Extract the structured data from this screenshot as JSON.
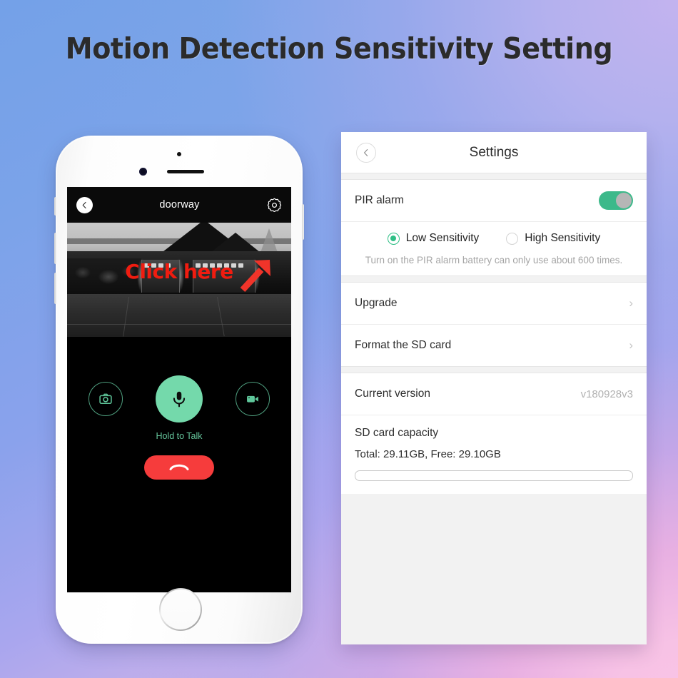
{
  "page": {
    "title": "Motion Detection Sensitivity Setting",
    "bg_from": "#74a1e8",
    "bg_to": "#f2c0e4"
  },
  "phone": {
    "app": {
      "back_icon": "chevron-left-icon",
      "title": "doorway",
      "gear_icon": "gear-icon"
    },
    "annotation": {
      "text": "Click here",
      "color": "#f01c10",
      "arrow_icon": "arrow-up-right-icon"
    },
    "controls": {
      "snapshot_icon": "camera-icon",
      "talk_icon": "microphone-icon",
      "record_icon": "video-camera-icon",
      "talk_label": "Hold to Talk",
      "hangup_icon": "phone-hangup-icon",
      "accent": "#74d9ab",
      "hangup_color": "#f63c3c"
    }
  },
  "settings": {
    "header": {
      "back_icon": "chevron-left-icon",
      "title": "Settings"
    },
    "pir": {
      "label": "PIR alarm",
      "toggle_on": true,
      "toggle_color": "#3cb98a",
      "options": [
        {
          "label": "Low Sensitivity",
          "selected": true
        },
        {
          "label": "High Sensitivity",
          "selected": false
        }
      ],
      "hint": "Turn on the PIR alarm battery can only use about 600 times."
    },
    "actions": [
      {
        "label": "Upgrade",
        "chevron": "›"
      },
      {
        "label": "Format the SD card",
        "chevron": "›"
      }
    ],
    "version": {
      "label": "Current version",
      "value": "v180928v3"
    },
    "storage": {
      "label": "SD card capacity",
      "detail": "Total: 29.11GB, Free: 29.10GB"
    }
  }
}
